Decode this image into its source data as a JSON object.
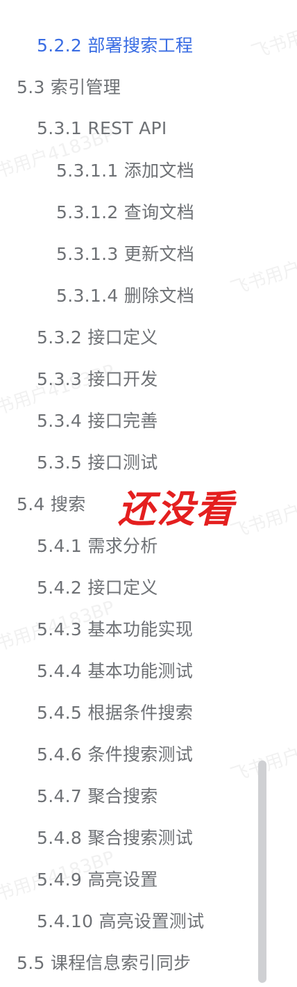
{
  "toc": [
    {
      "level": 2,
      "label": "5.2.2 部署搜索工程",
      "active": true
    },
    {
      "level": 1,
      "label": "5.3 索引管理"
    },
    {
      "level": 2,
      "label": "5.3.1 REST API"
    },
    {
      "level": 3,
      "label": "5.3.1.1 添加文档"
    },
    {
      "level": 3,
      "label": "5.3.1.2 查询文档"
    },
    {
      "level": 3,
      "label": "5.3.1.3 更新文档"
    },
    {
      "level": 3,
      "label": "5.3.1.4 删除文档"
    },
    {
      "level": 2,
      "label": "5.3.2 接口定义"
    },
    {
      "level": 2,
      "label": "5.3.3 接口开发"
    },
    {
      "level": 2,
      "label": "5.3.4 接口完善"
    },
    {
      "level": 2,
      "label": "5.3.5 接口测试"
    },
    {
      "level": 1,
      "label": "5.4 搜索"
    },
    {
      "level": 2,
      "label": "5.4.1 需求分析"
    },
    {
      "level": 2,
      "label": "5.4.2 接口定义"
    },
    {
      "level": 2,
      "label": "5.4.3 基本功能实现"
    },
    {
      "level": 2,
      "label": "5.4.4 基本功能测试"
    },
    {
      "level": 2,
      "label": "5.4.5 根据条件搜索"
    },
    {
      "level": 2,
      "label": "5.4.6 条件搜索测试"
    },
    {
      "level": 2,
      "label": "5.4.7 聚合搜索"
    },
    {
      "level": 2,
      "label": "5.4.8 聚合搜索测试"
    },
    {
      "level": 2,
      "label": "5.4.9 高亮设置"
    },
    {
      "level": 2,
      "label": "5.4.10 高亮设置测试"
    },
    {
      "level": 1,
      "label": "5.5 课程信息索引同步"
    }
  ],
  "annotation": "还没看",
  "watermarks": [
    "飞书用户",
    "书用户4183BP",
    "飞书用户",
    "书用户4183BP",
    "飞书用户",
    "书用户4183BP",
    "飞书用户",
    "书用户4183BP"
  ],
  "colors": {
    "active": "#3a6de3",
    "text": "#6e7175",
    "annotation": "#e41f1f"
  }
}
